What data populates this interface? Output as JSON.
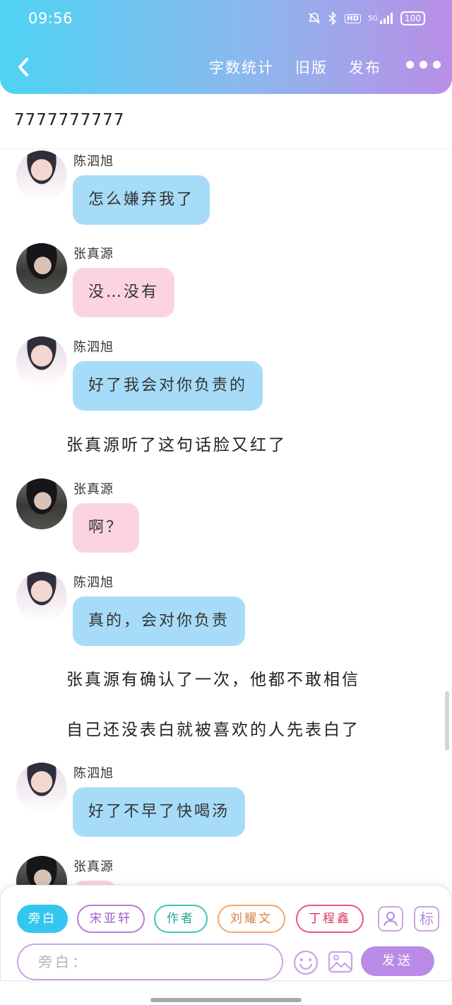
{
  "status_bar": {
    "time": "09:56",
    "icons": [
      "bell-mute-icon",
      "bluetooth-icon",
      "hd-icon",
      "signal-5g-icon",
      "battery-icon"
    ],
    "hd": "HD",
    "network": "5G",
    "battery": "100"
  },
  "header": {
    "back_icon": "chevron-left-icon",
    "actions": [
      "字数统计",
      "旧版",
      "发布"
    ],
    "more_icon": "more-dots-icon",
    "gradient": [
      "#4fd3f3",
      "#b98ee6"
    ]
  },
  "title": "7777777777",
  "messages": [
    {
      "type": "dialog",
      "speaker": "陈泗旭",
      "avatar": "chen",
      "bubble": "blue",
      "text": "怎么嫌弃我了"
    },
    {
      "type": "dialog",
      "speaker": "张真源",
      "avatar": "zhang",
      "bubble": "pink",
      "text": "没…没有"
    },
    {
      "type": "dialog",
      "speaker": "陈泗旭",
      "avatar": "chen",
      "bubble": "blue",
      "text": "好了我会对你负责的"
    },
    {
      "type": "narration",
      "text": "张真源听了这句话脸又红了"
    },
    {
      "type": "dialog",
      "speaker": "张真源",
      "avatar": "zhang",
      "bubble": "pink",
      "text": "啊？"
    },
    {
      "type": "dialog",
      "speaker": "陈泗旭",
      "avatar": "chen",
      "bubble": "blue",
      "text": "真的，会对你负责"
    },
    {
      "type": "narration",
      "text": "张真源有确认了一次，他都不敢相信"
    },
    {
      "type": "narration",
      "text": "自己还没表白就被喜欢的人先表白了"
    },
    {
      "type": "dialog",
      "speaker": "陈泗旭",
      "avatar": "chen",
      "bubble": "blue",
      "text": "好了不早了快喝汤"
    },
    {
      "type": "dialog",
      "speaker": "张真源",
      "avatar": "zhang",
      "bubble": "pink",
      "text": ""
    }
  ],
  "roles": [
    "旁白",
    "宋亚轩",
    "作者",
    "刘耀文",
    "丁程鑫"
  ],
  "tools": {
    "contact_icon": "contact-icon",
    "mark_label": "标"
  },
  "input": {
    "placeholder": "旁白：",
    "emoji_icon": "emoji-icon",
    "image_icon": "image-icon"
  },
  "send_label": "发送",
  "colors": {
    "blue_bubble": "#a6dcf8",
    "pink_bubble": "#fbd4df",
    "accent": "#b98be6",
    "narration_chip": "#34c6ef"
  }
}
